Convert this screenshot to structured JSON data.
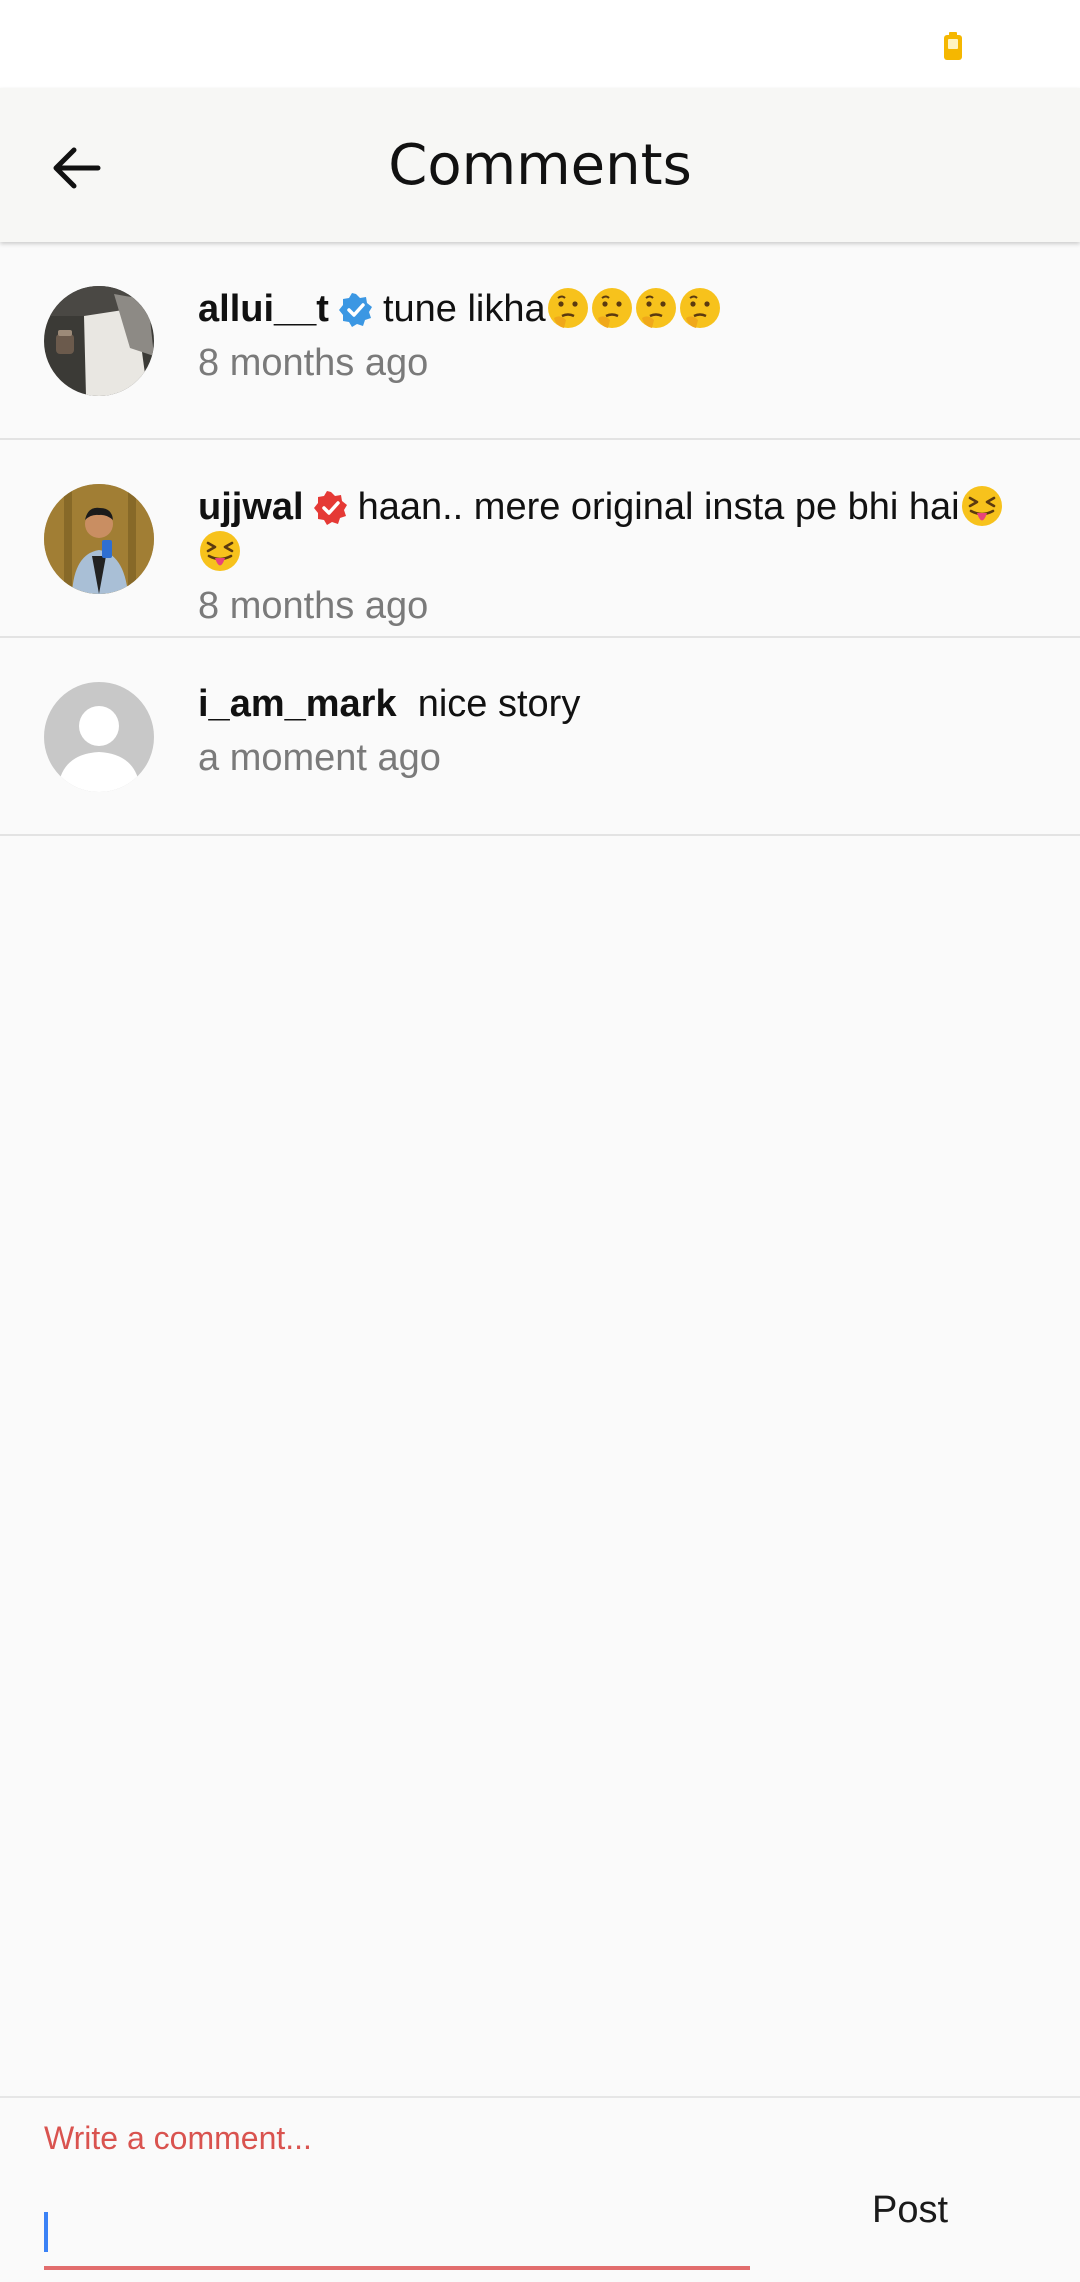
{
  "colors": {
    "battery": "#f5b700",
    "verified_blue": "#3b97e3",
    "verified_red": "#e53935",
    "input_accent": "#e26d6d",
    "caret": "#3b82f6"
  },
  "header": {
    "title": "Comments",
    "back_icon": "arrow-left-icon"
  },
  "comments": [
    {
      "username": "allui__t",
      "badge": "verified-blue",
      "text": "tune likha",
      "emoji": [
        "thinking-face",
        "thinking-face",
        "thinking-face",
        "thinking-face"
      ],
      "time": "8 months ago"
    },
    {
      "username": "ujjwal",
      "badge": "verified-red",
      "text": "haan.. mere original insta pe bhi hai",
      "emoji": [
        "squinting-tongue-face",
        "squinting-tongue-face"
      ],
      "time": "8 months ago"
    },
    {
      "username": "i_am_mark",
      "badge": "",
      "text": "nice story",
      "emoji": [],
      "time": "a moment ago"
    }
  ],
  "input": {
    "placeholder": "Write a comment...",
    "value": "",
    "post_label": "Post"
  }
}
